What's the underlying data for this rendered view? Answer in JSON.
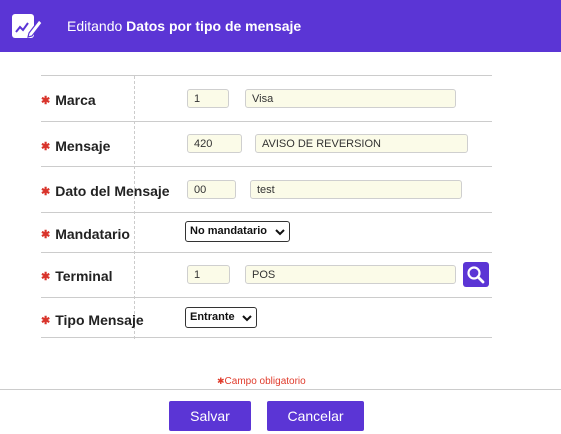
{
  "header": {
    "prefix": "Editando",
    "title": "Datos por tipo de mensaje",
    "icon": "edit-chart-icon"
  },
  "fields": {
    "marca": {
      "label": "Marca",
      "code": "1",
      "name": "Visa"
    },
    "mensaje": {
      "label": "Mensaje",
      "code": "420",
      "name": "AVISO DE REVERSION"
    },
    "dato": {
      "label": "Dato del Mensaje",
      "code": "00",
      "name": "test"
    },
    "mandatario": {
      "label": "Mandatario",
      "selected": "No mandatario"
    },
    "terminal": {
      "label": "Terminal",
      "code": "1",
      "name": "POS"
    },
    "tipo": {
      "label": "Tipo Mensaje",
      "selected": "Entrante"
    }
  },
  "required_marker": "✱",
  "required_note": "Campo obligatorio",
  "buttons": {
    "save": "Salvar",
    "cancel": "Cancelar"
  },
  "colors": {
    "accent": "#5b35d5",
    "required": "#d9342b",
    "input_bg": "#fbfbe8"
  }
}
